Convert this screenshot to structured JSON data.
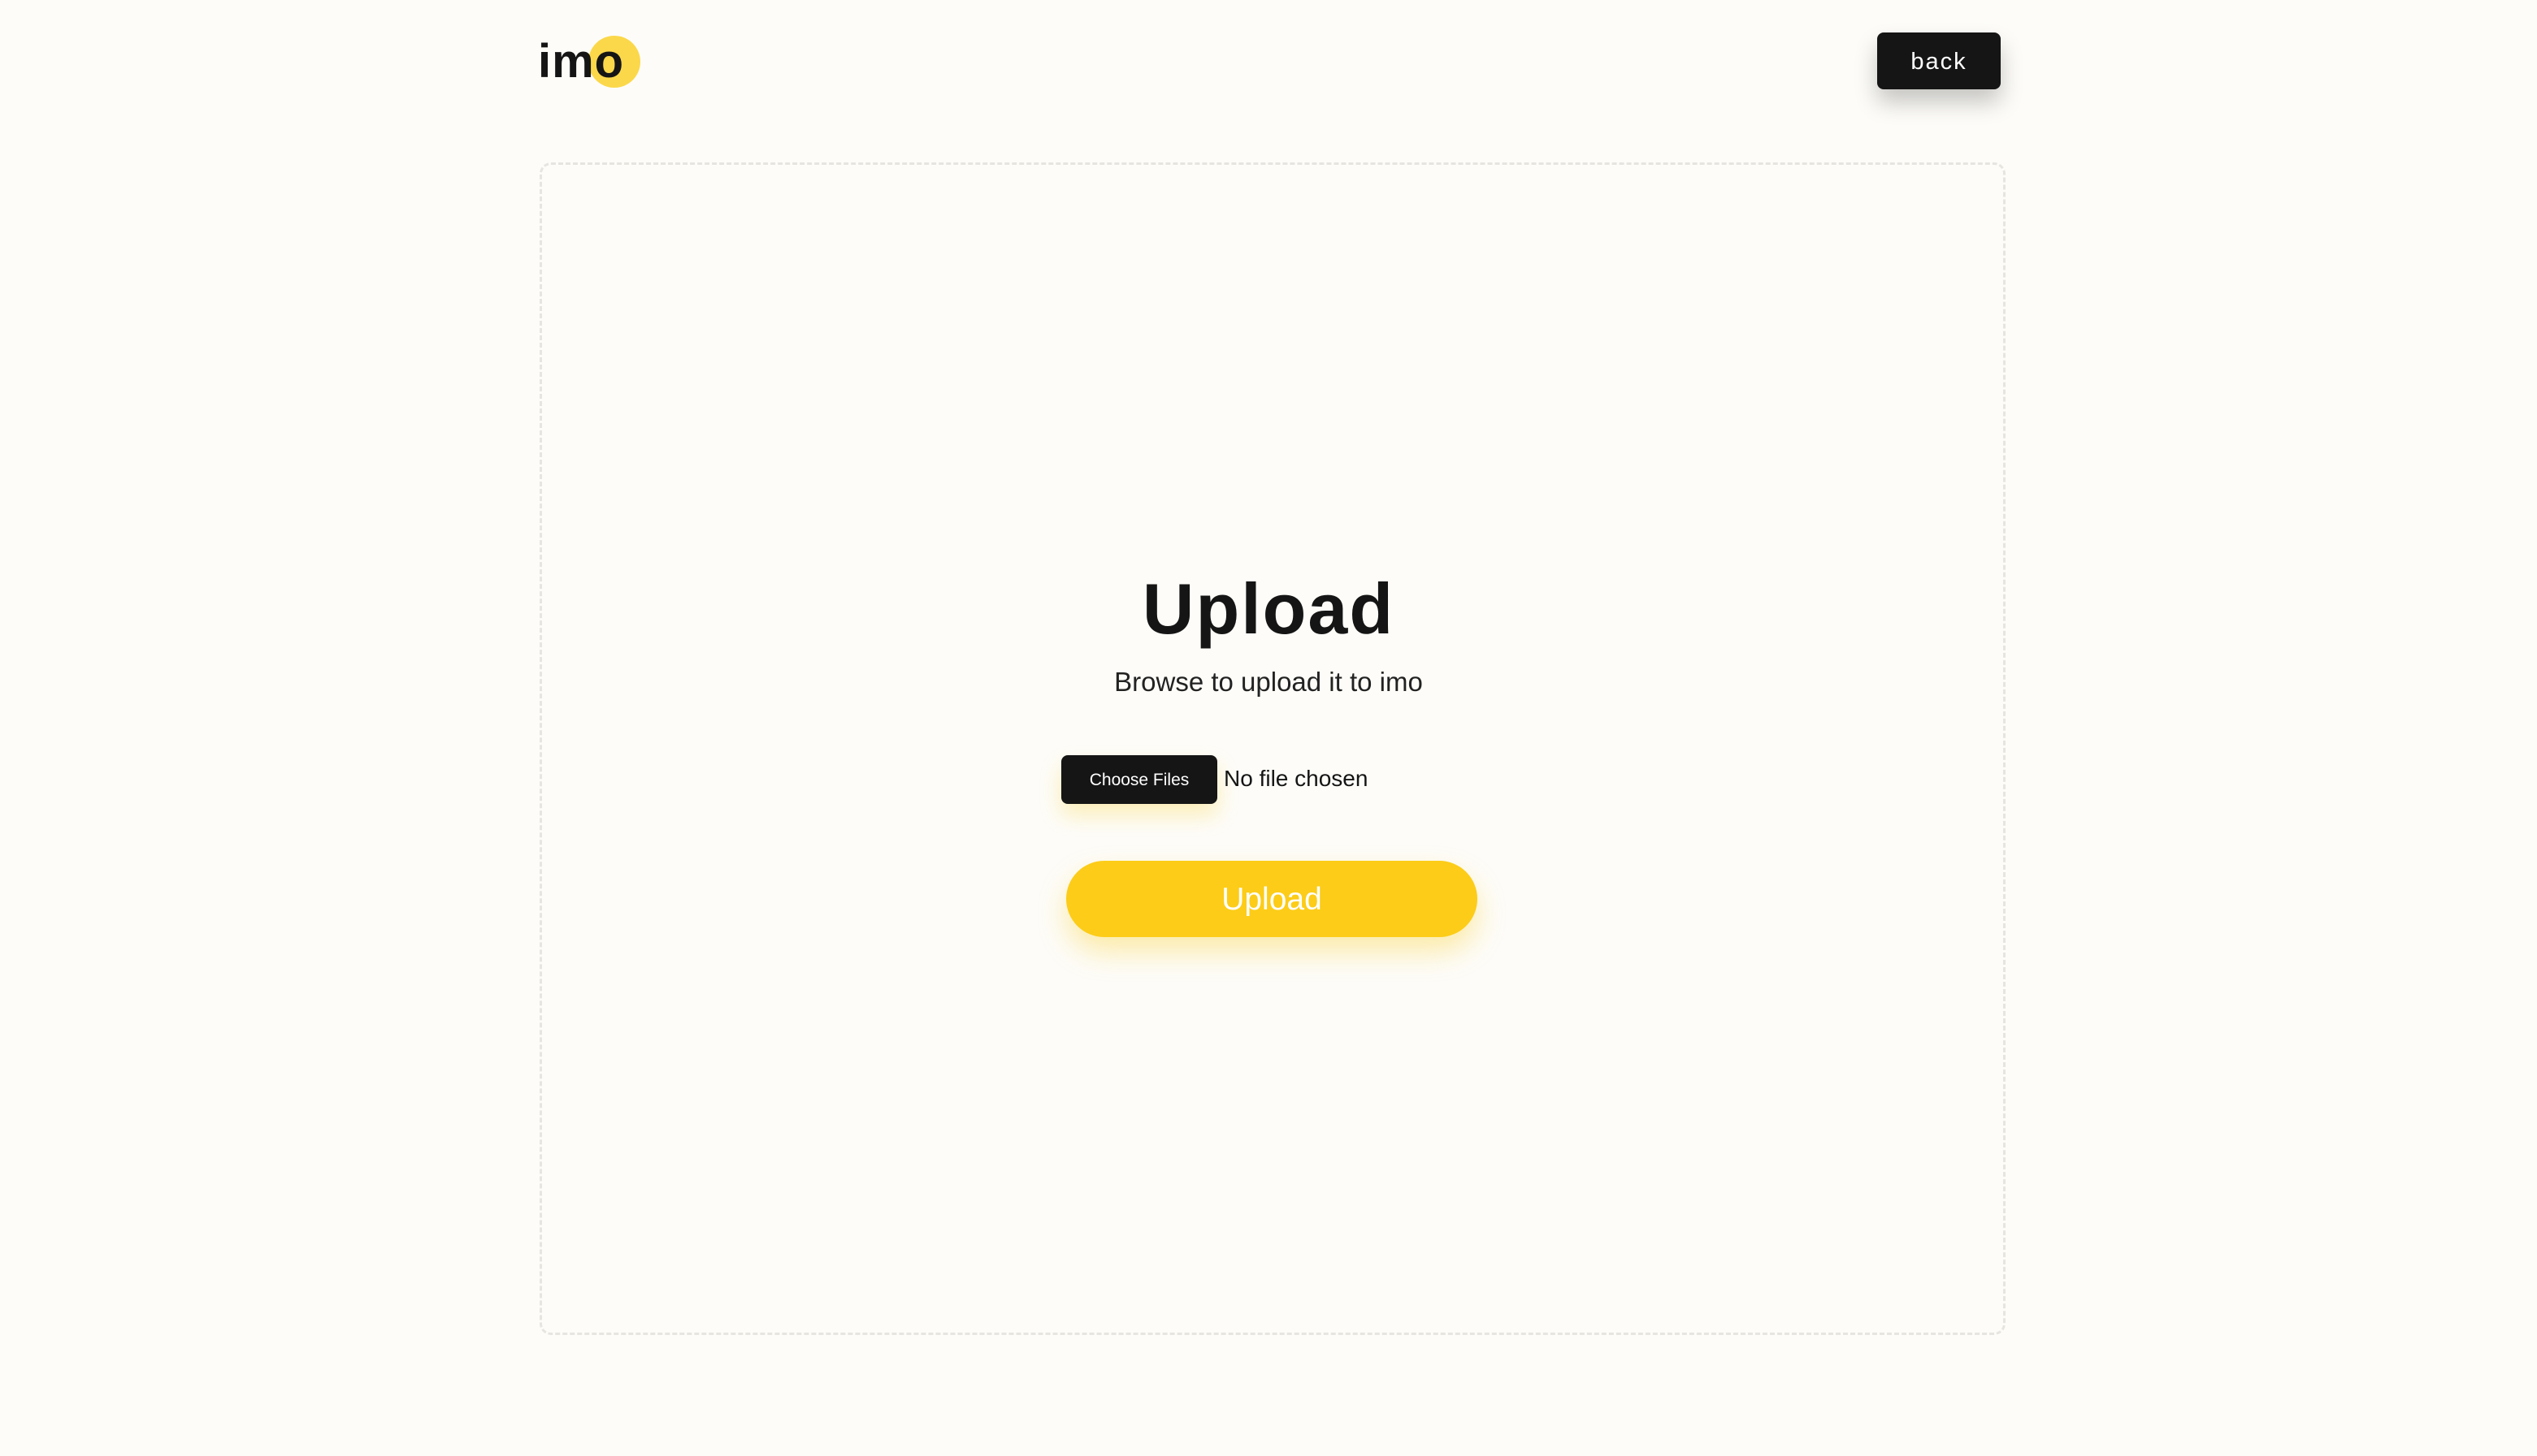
{
  "header": {
    "logo_text": "imo",
    "back_label": "back"
  },
  "upload_panel": {
    "title": "Upload",
    "subtitle": "Browse to upload it to imo",
    "choose_files_label": "Choose Files",
    "file_status": "No file chosen",
    "upload_label": "Upload"
  },
  "colors": {
    "background": "#fdfcf8",
    "accent_yellow": "#fccc18",
    "logo_dot": "#fbd84a",
    "dark": "#151515",
    "dashed_border": "#e7e5e0"
  }
}
